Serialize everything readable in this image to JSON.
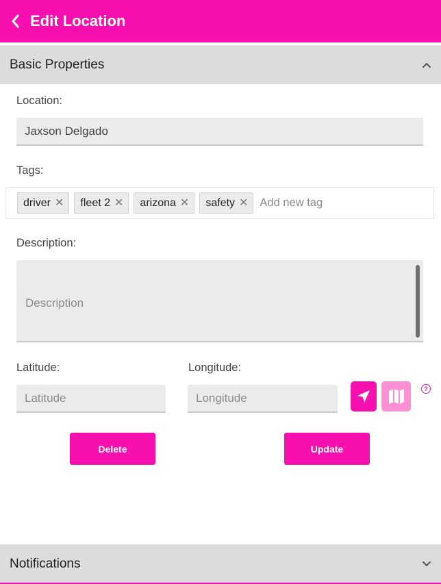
{
  "header": {
    "title": "Edit Location"
  },
  "sections": {
    "basic": "Basic Properties",
    "notifications": "Notifications"
  },
  "form": {
    "location_label": "Location:",
    "location_value": "Jaxson Delgado",
    "tags_label": "Tags:",
    "tags": [
      {
        "label": "driver"
      },
      {
        "label": "fleet 2"
      },
      {
        "label": "arizona"
      },
      {
        "label": "safety"
      }
    ],
    "tag_placeholder": "Add new tag",
    "description_label": "Description:",
    "description_placeholder": "Description",
    "latitude_label": "Latitude:",
    "latitude_placeholder": "Latitude",
    "longitude_label": "Longitude:",
    "longitude_placeholder": "Longitude"
  },
  "buttons": {
    "delete": "Delete",
    "update": "Update"
  },
  "colors": {
    "accent": "#f70fb0",
    "accent_light": "#ff8fd4",
    "section_bg": "#dcdcdc",
    "input_bg": "#ebebeb"
  },
  "icons": [
    "back-icon",
    "chevron-up-icon",
    "chevron-down-icon",
    "close-icon",
    "navigation-arrow-icon",
    "map-icon",
    "help-icon"
  ]
}
